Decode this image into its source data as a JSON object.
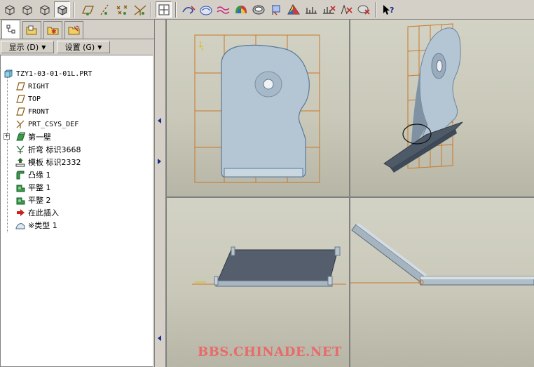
{
  "toolbar": {
    "buttons": [
      {
        "icon": "isometric-wireframe-icon"
      },
      {
        "icon": "hidden-line-icon"
      },
      {
        "icon": "no-hidden-icon"
      },
      {
        "icon": "shading-icon",
        "pressed": true
      },
      {
        "icon": "datum-plane-display-icon"
      },
      {
        "icon": "datum-axis-display-icon"
      },
      {
        "icon": "datum-point-display-icon"
      },
      {
        "icon": "coordinate-system-display-icon"
      },
      {
        "icon": "view-layout-icon"
      },
      {
        "icon": "sketch-tool-icon-1"
      },
      {
        "icon": "sketch-tool-icon-2"
      },
      {
        "icon": "curve-tool-icon"
      },
      {
        "icon": "render-tool-icon"
      },
      {
        "icon": "shell-tool-icon"
      },
      {
        "icon": "flag-tool-icon"
      },
      {
        "icon": "color-tool-icon"
      },
      {
        "icon": "measure-tool-icon-1"
      },
      {
        "icon": "measure-tool-icon-2"
      },
      {
        "icon": "analysis-tool-icon"
      },
      {
        "icon": "delete-tool-icon"
      },
      {
        "icon": "whats-this-help-icon"
      }
    ]
  },
  "left_panel": {
    "tabs": [
      {
        "icon": "model-tree-tab-icon",
        "active": true
      },
      {
        "icon": "folder-browser-tab-icon"
      },
      {
        "icon": "favorites-tab-icon"
      },
      {
        "icon": "connections-tab-icon"
      }
    ],
    "show_menu": "显示 (D)",
    "settings_menu": "设置 (G)",
    "tree": [
      {
        "label": "TZY1-03-01-01L.PRT",
        "icon": "part-icon",
        "level": 0
      },
      {
        "label": "RIGHT",
        "icon": "datum-plane-icon",
        "level": 1
      },
      {
        "label": "TOP",
        "icon": "datum-plane-icon",
        "level": 1
      },
      {
        "label": "FRONT",
        "icon": "datum-plane-icon",
        "level": 1
      },
      {
        "label": "PRT_CSYS_DEF",
        "icon": "csys-icon",
        "level": 1
      },
      {
        "label": "第一壁",
        "icon": "first-wall-icon",
        "level": 1,
        "expandable": true
      },
      {
        "label": "折弯 标识3668",
        "icon": "bend-icon",
        "level": 1
      },
      {
        "label": "模板 标识2332",
        "icon": "template-icon",
        "level": 1
      },
      {
        "label": "凸缘 1",
        "icon": "flange-icon",
        "level": 1
      },
      {
        "label": "平整 1",
        "icon": "flat-wall-icon",
        "level": 1
      },
      {
        "label": "平整 2",
        "icon": "flat-wall-icon",
        "level": 1
      },
      {
        "label": "在此插入",
        "icon": "insert-here-arrow-icon",
        "level": 1
      },
      {
        "label": "※类型 1",
        "icon": "type-feature-icon",
        "level": 1
      }
    ]
  },
  "viewports": {
    "count": 4,
    "accent_grid": "#c8782a",
    "part_color": "#a9bccc"
  },
  "watermark": "BBS.CHINADE.NET"
}
